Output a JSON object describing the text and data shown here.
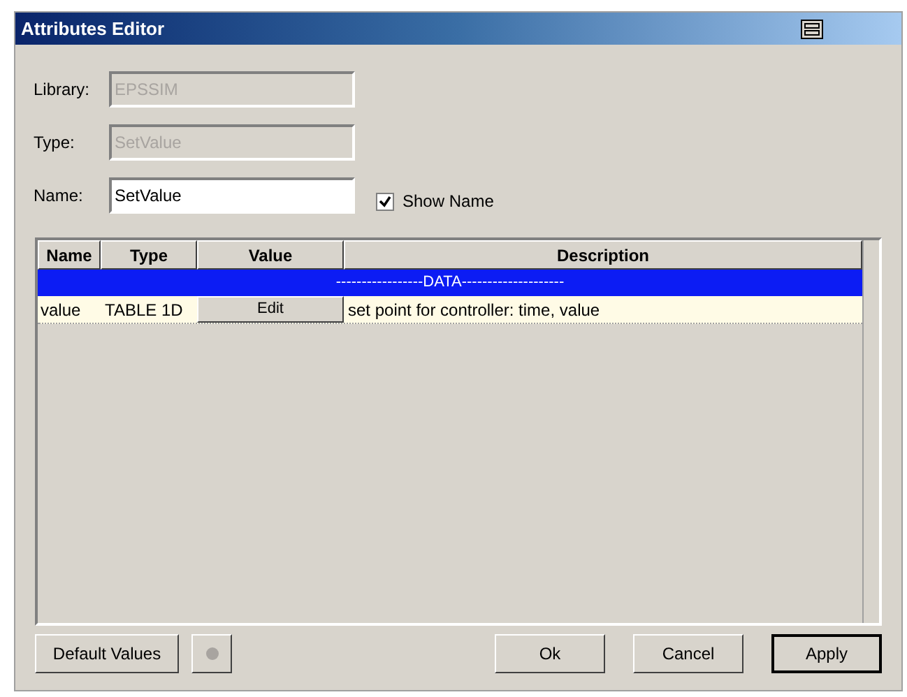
{
  "window": {
    "title": "Attributes Editor"
  },
  "fields": [
    {
      "label": "Library:",
      "value": "EPSSIM",
      "disabled": true
    },
    {
      "label": "Type:",
      "value": "SetValue",
      "disabled": true
    },
    {
      "label": "Name:",
      "value": "SetValue",
      "disabled": false
    }
  ],
  "show_name": {
    "label": "Show Name",
    "checked": true
  },
  "table": {
    "columns": [
      "Name",
      "Type",
      "Value",
      "Description"
    ],
    "rows": [
      {
        "kind": "section",
        "label": "-----------------DATA--------------------"
      },
      {
        "kind": "attribute",
        "name": "value",
        "type": "TABLE 1D",
        "button": "Edit",
        "description": "set point for controller: time, value"
      }
    ]
  },
  "left_buttons": [
    {
      "label": "Default Values",
      "kind": "text"
    },
    {
      "kind": "icon",
      "disabled": true
    }
  ],
  "right_buttons": [
    {
      "label": "Ok",
      "default": false
    },
    {
      "label": "Cancel",
      "default": false
    },
    {
      "label": "Apply",
      "default": true
    }
  ]
}
